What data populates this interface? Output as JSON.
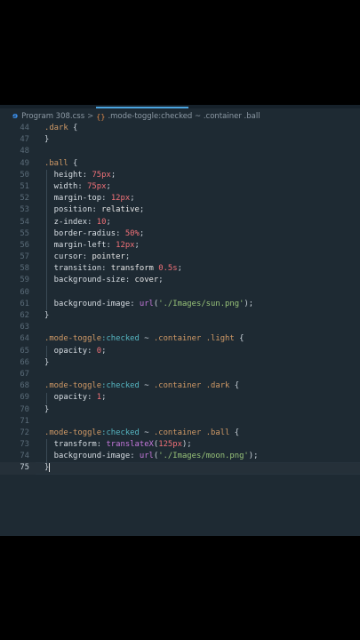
{
  "breadcrumb": {
    "file_icon": "ɘ",
    "file": "Program 308.css",
    "separator": ">",
    "selector_icon": "{}",
    "selector": ".mode-toggle:checked ~ .container .ball"
  },
  "lines": [
    {
      "n": "44",
      "tokens": [
        {
          "t": ".dark",
          "c": "sel"
        },
        {
          "t": " {",
          "c": "punc"
        }
      ]
    },
    {
      "n": "47",
      "tokens": [
        {
          "t": "}",
          "c": "punc"
        }
      ]
    },
    {
      "n": "48",
      "tokens": []
    },
    {
      "n": "49",
      "tokens": [
        {
          "t": ".ball",
          "c": "sel"
        },
        {
          "t": " {",
          "c": "punc"
        }
      ]
    },
    {
      "n": "50",
      "tokens": [
        {
          "t": "  height",
          "c": "prop"
        },
        {
          "t": ": ",
          "c": "punc"
        },
        {
          "t": "75px",
          "c": "num"
        },
        {
          "t": ";",
          "c": "punc"
        }
      ]
    },
    {
      "n": "51",
      "tokens": [
        {
          "t": "  width",
          "c": "prop"
        },
        {
          "t": ": ",
          "c": "punc"
        },
        {
          "t": "75px",
          "c": "num"
        },
        {
          "t": ";",
          "c": "punc"
        }
      ]
    },
    {
      "n": "52",
      "tokens": [
        {
          "t": "  margin-top",
          "c": "prop"
        },
        {
          "t": ": ",
          "c": "punc"
        },
        {
          "t": "12px",
          "c": "num"
        },
        {
          "t": ";",
          "c": "punc"
        }
      ]
    },
    {
      "n": "53",
      "tokens": [
        {
          "t": "  position",
          "c": "prop"
        },
        {
          "t": ": ",
          "c": "punc"
        },
        {
          "t": "relative",
          "c": "kw"
        },
        {
          "t": ";",
          "c": "punc"
        }
      ]
    },
    {
      "n": "54",
      "tokens": [
        {
          "t": "  z-index",
          "c": "prop"
        },
        {
          "t": ": ",
          "c": "punc"
        },
        {
          "t": "10",
          "c": "num"
        },
        {
          "t": ";",
          "c": "punc"
        }
      ]
    },
    {
      "n": "55",
      "tokens": [
        {
          "t": "  border-radius",
          "c": "prop"
        },
        {
          "t": ": ",
          "c": "punc"
        },
        {
          "t": "50%",
          "c": "num"
        },
        {
          "t": ";",
          "c": "punc"
        }
      ]
    },
    {
      "n": "56",
      "tokens": [
        {
          "t": "  margin-left",
          "c": "prop"
        },
        {
          "t": ": ",
          "c": "punc"
        },
        {
          "t": "12px",
          "c": "num"
        },
        {
          "t": ";",
          "c": "punc"
        }
      ]
    },
    {
      "n": "57",
      "tokens": [
        {
          "t": "  cursor",
          "c": "prop"
        },
        {
          "t": ": ",
          "c": "punc"
        },
        {
          "t": "pointer",
          "c": "kw"
        },
        {
          "t": ";",
          "c": "punc"
        }
      ]
    },
    {
      "n": "58",
      "tokens": [
        {
          "t": "  transition",
          "c": "prop"
        },
        {
          "t": ": ",
          "c": "punc"
        },
        {
          "t": "transform",
          "c": "kw"
        },
        {
          "t": " ",
          "c": "punc"
        },
        {
          "t": "0.5s",
          "c": "num"
        },
        {
          "t": ";",
          "c": "punc"
        }
      ]
    },
    {
      "n": "59",
      "tokens": [
        {
          "t": "  background-size",
          "c": "prop"
        },
        {
          "t": ": ",
          "c": "punc"
        },
        {
          "t": "cover",
          "c": "kw"
        },
        {
          "t": ";",
          "c": "punc"
        }
      ]
    },
    {
      "n": "60",
      "tokens": []
    },
    {
      "n": "61",
      "tokens": [
        {
          "t": "  background-image",
          "c": "prop"
        },
        {
          "t": ": ",
          "c": "punc"
        },
        {
          "t": "url",
          "c": "fn"
        },
        {
          "t": "(",
          "c": "punc"
        },
        {
          "t": "'./Images/sun.png'",
          "c": "str"
        },
        {
          "t": ");",
          "c": "punc"
        }
      ]
    },
    {
      "n": "62",
      "tokens": [
        {
          "t": "}",
          "c": "punc"
        }
      ]
    },
    {
      "n": "63",
      "tokens": []
    },
    {
      "n": "64",
      "tokens": [
        {
          "t": ".mode-toggle",
          "c": "sel"
        },
        {
          "t": ":checked",
          "c": "pseudo"
        },
        {
          "t": " ~ ",
          "c": "punc"
        },
        {
          "t": ".container",
          "c": "sel"
        },
        {
          "t": " ",
          "c": "punc"
        },
        {
          "t": ".light",
          "c": "sel"
        },
        {
          "t": " {",
          "c": "punc"
        }
      ]
    },
    {
      "n": "65",
      "tokens": [
        {
          "t": "  opacity",
          "c": "prop"
        },
        {
          "t": ": ",
          "c": "punc"
        },
        {
          "t": "0",
          "c": "num"
        },
        {
          "t": ";",
          "c": "punc"
        }
      ]
    },
    {
      "n": "66",
      "tokens": [
        {
          "t": "}",
          "c": "punc"
        }
      ]
    },
    {
      "n": "67",
      "tokens": []
    },
    {
      "n": "68",
      "tokens": [
        {
          "t": ".mode-toggle",
          "c": "sel"
        },
        {
          "t": ":checked",
          "c": "pseudo"
        },
        {
          "t": " ~ ",
          "c": "punc"
        },
        {
          "t": ".container",
          "c": "sel"
        },
        {
          "t": " ",
          "c": "punc"
        },
        {
          "t": ".dark",
          "c": "sel"
        },
        {
          "t": " {",
          "c": "punc"
        }
      ]
    },
    {
      "n": "69",
      "tokens": [
        {
          "t": "  opacity",
          "c": "prop"
        },
        {
          "t": ": ",
          "c": "punc"
        },
        {
          "t": "1",
          "c": "num"
        },
        {
          "t": ";",
          "c": "punc"
        }
      ]
    },
    {
      "n": "70",
      "tokens": [
        {
          "t": "}",
          "c": "punc"
        }
      ]
    },
    {
      "n": "71",
      "tokens": []
    },
    {
      "n": "72",
      "tokens": [
        {
          "t": ".mode-toggle",
          "c": "sel"
        },
        {
          "t": ":checked",
          "c": "pseudo"
        },
        {
          "t": " ~ ",
          "c": "punc"
        },
        {
          "t": ".container",
          "c": "sel"
        },
        {
          "t": " ",
          "c": "punc"
        },
        {
          "t": ".ball",
          "c": "sel"
        },
        {
          "t": " {",
          "c": "punc"
        }
      ]
    },
    {
      "n": "73",
      "tokens": [
        {
          "t": "  transform",
          "c": "prop"
        },
        {
          "t": ": ",
          "c": "punc"
        },
        {
          "t": "translateX",
          "c": "fn"
        },
        {
          "t": "(",
          "c": "punc"
        },
        {
          "t": "125px",
          "c": "num"
        },
        {
          "t": ");",
          "c": "punc"
        }
      ]
    },
    {
      "n": "74",
      "tokens": [
        {
          "t": "  background-image",
          "c": "prop"
        },
        {
          "t": ": ",
          "c": "punc"
        },
        {
          "t": "url",
          "c": "fn"
        },
        {
          "t": "(",
          "c": "punc"
        },
        {
          "t": "'./Images/moon.png'",
          "c": "str"
        },
        {
          "t": ");",
          "c": "punc"
        }
      ]
    },
    {
      "n": "75",
      "tokens": [
        {
          "t": "}",
          "c": "punc"
        }
      ],
      "active": true
    }
  ]
}
